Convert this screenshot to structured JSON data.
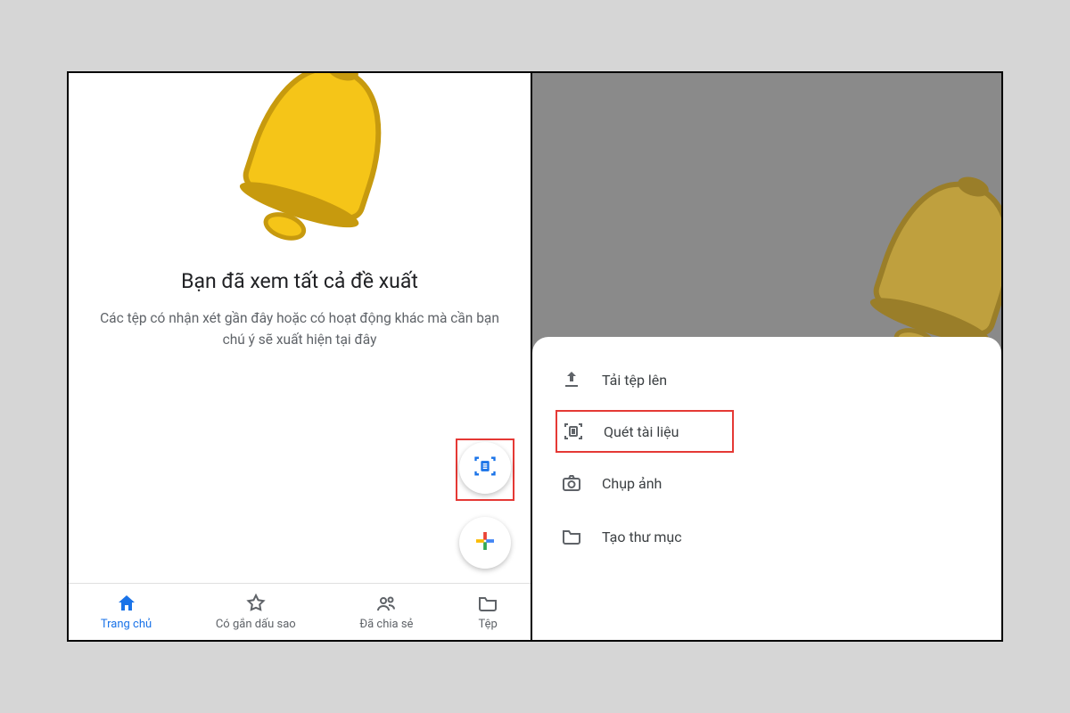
{
  "left": {
    "empty_title": "Bạn đã xem tất cả đề xuất",
    "empty_sub": "Các tệp có nhận xét gần đây hoặc có hoạt động khác mà cần bạn chú ý sẽ xuất hiện tại đây",
    "nav": {
      "home": "Trang chủ",
      "starred": "Có gắn dấu sao",
      "shared": "Đã chia sẻ",
      "files": "Tệp"
    }
  },
  "right": {
    "sheet": {
      "upload": "Tải tệp lên",
      "scan": "Quét tài liệu",
      "photo": "Chụp ảnh",
      "folder": "Tạo thư mục"
    }
  }
}
